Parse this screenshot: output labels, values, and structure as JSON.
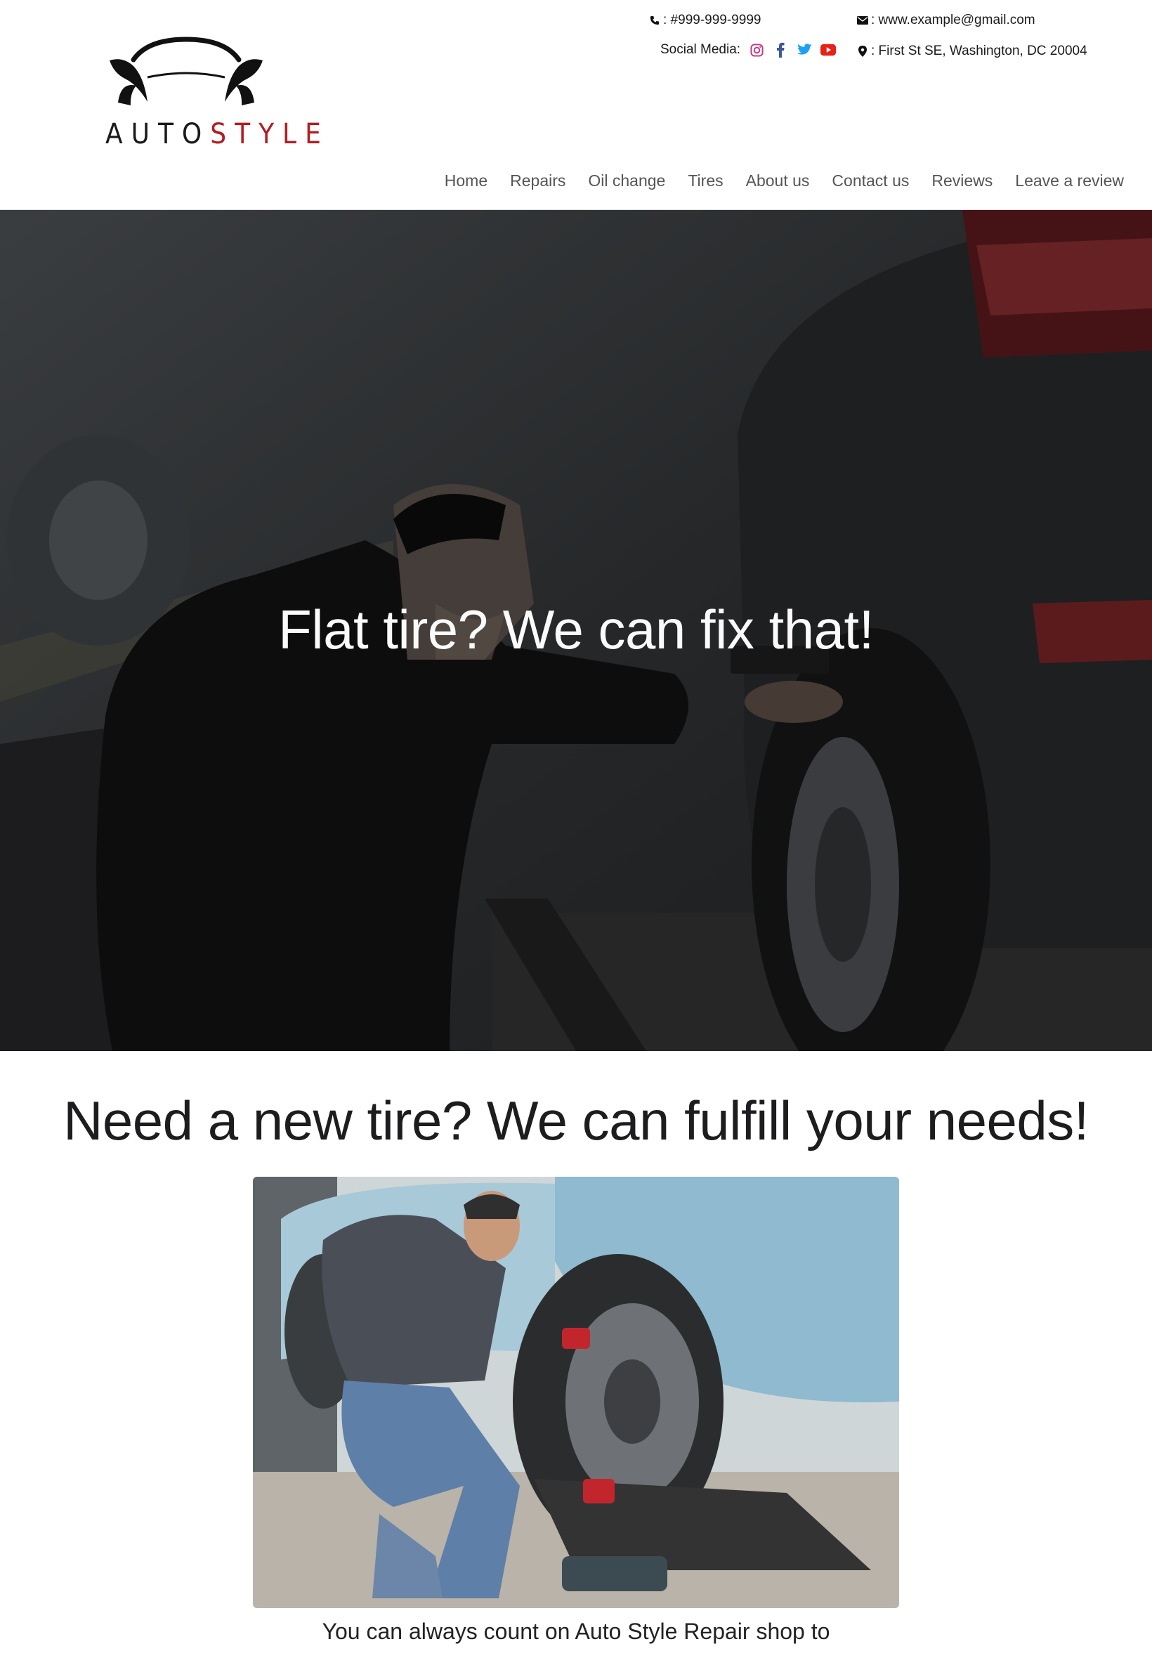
{
  "brand": {
    "logo_text_1": "AUTO",
    "logo_text_2": "STYLE",
    "accent_color": "#b01e24"
  },
  "contact": {
    "phone": ": #999-999-9999",
    "email": ": www.example@gmail.com",
    "address": ": First St SE, Washington, DC 20004",
    "social_label": "Social Media:",
    "social_icons": [
      "instagram-icon",
      "facebook-icon",
      "twitter-icon",
      "youtube-icon"
    ]
  },
  "nav": {
    "items": [
      "Home",
      "Repairs",
      "Oil change",
      "Tires",
      "About us",
      "Contact us",
      "Reviews",
      "Leave a review"
    ]
  },
  "hero": {
    "title": "Flat tire? We can fix that!"
  },
  "section": {
    "title": "Need a new tire? We can fulfill your needs!",
    "body": "You can always count on Auto Style Repair shop to"
  }
}
